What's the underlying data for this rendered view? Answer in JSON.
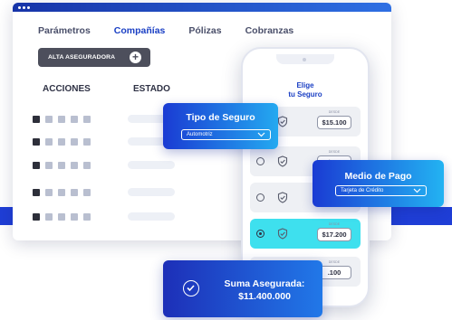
{
  "nav": {
    "items": [
      "Parámetros",
      "Compañías",
      "Pólizas",
      "Cobranzas"
    ],
    "active": 1
  },
  "toolbar": {
    "alta_label": "ALTA ASEGURADORA",
    "plus_symbol": "+"
  },
  "table": {
    "headers": [
      "ACCIONES",
      "ESTADO"
    ],
    "action_icons": [
      "document-icon",
      "swap-icon",
      "lock-icon",
      "calendar-icon",
      "print-icon"
    ]
  },
  "phone": {
    "title_line1": "Elige",
    "title_line2": "tu Seguro",
    "options": [
      {
        "from_label": "DESDE",
        "price": "$15.100",
        "selected": false
      },
      {
        "from_label": "DESDE",
        "price": "$14.",
        "selected": false
      },
      {
        "from_label": "DESDE",
        "price": "$16.",
        "selected": false
      },
      {
        "from_label": "DESDE",
        "price": "$17.200",
        "selected": true
      },
      {
        "from_label": "DESDE",
        "price": ".100",
        "selected": false
      }
    ]
  },
  "tipo_seguro": {
    "title": "Tipo de Seguro",
    "value": "Automotriz"
  },
  "medio_pago": {
    "title": "Medio de Pago",
    "value": "Tarjeta de Crédito"
  },
  "suma": {
    "title": "Suma Asegurada:",
    "amount": "$11.400.000"
  },
  "colors": {
    "brand_dark": "#1a3bd3",
    "brand_light": "#24a9f0",
    "selected_card": "#3ee0ee",
    "active_nav": "#1a3fc4"
  }
}
